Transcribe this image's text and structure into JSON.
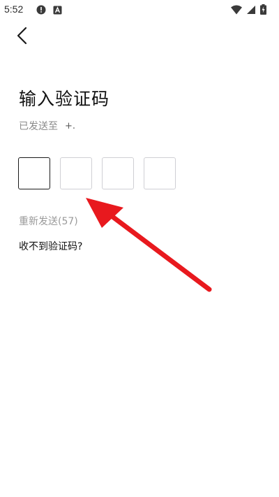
{
  "status_bar": {
    "time": "5:52",
    "left_icons": [
      "alert-icon",
      "a-icon"
    ],
    "right_icons": [
      "wifi-icon",
      "signal-icon",
      "battery-icon"
    ]
  },
  "header": {
    "back_icon": "chevron-left-icon"
  },
  "main": {
    "title": "输入验证码",
    "sent_to_label": "已发送至",
    "phone_number": "+.",
    "code_boxes": [
      "",
      "",
      "",
      ""
    ],
    "resend_label": "重新发送(57)",
    "help_label": "收不到验证码?"
  },
  "annotation": {
    "arrow_color": "#e8191e"
  }
}
